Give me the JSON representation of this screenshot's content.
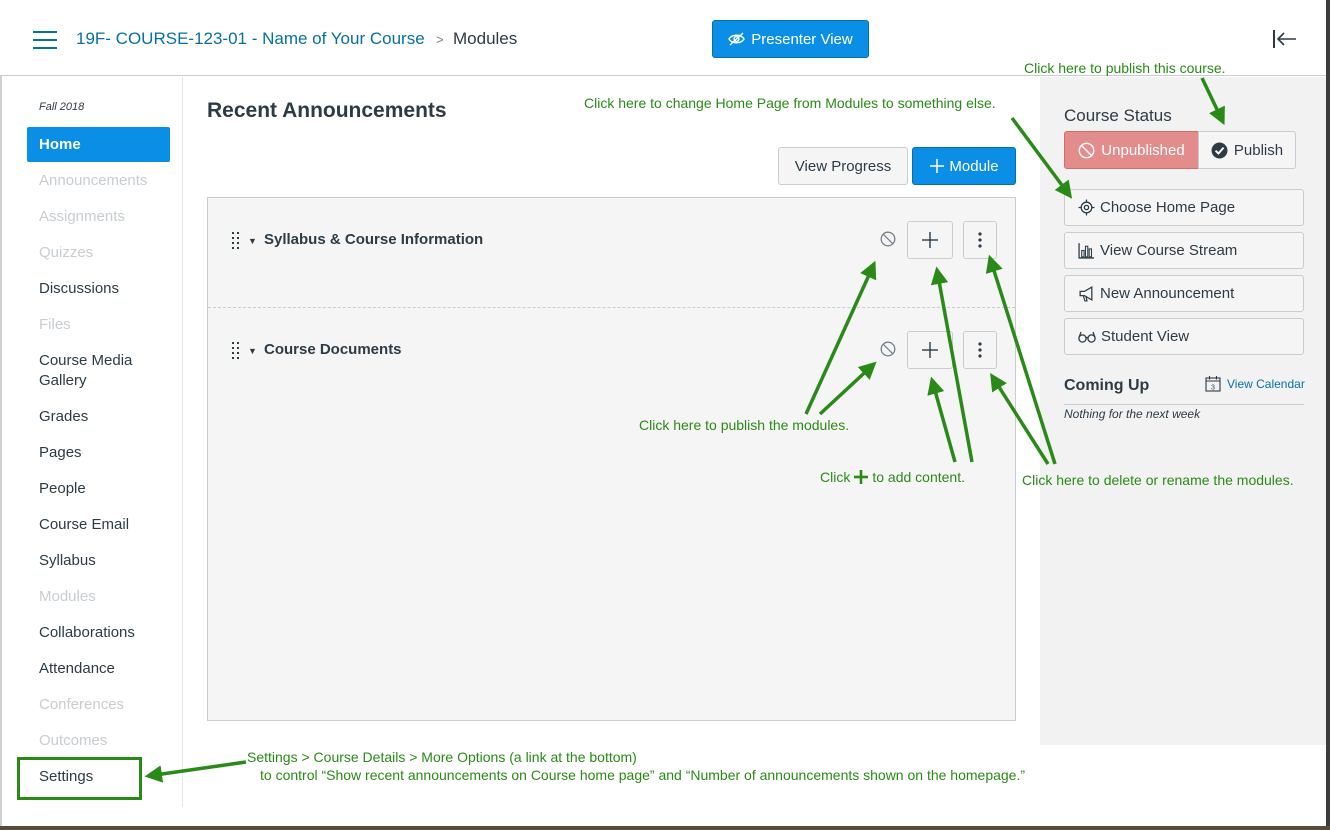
{
  "header": {
    "course_name": "19F- COURSE-123-01 - Name of Your Course",
    "separator": ">",
    "current_page": "Modules",
    "presenter_label": "Presenter View"
  },
  "sidebar": {
    "term": "Fall 2018",
    "items": [
      {
        "label": "Home",
        "state": "active"
      },
      {
        "label": "Announcements",
        "state": "hidden"
      },
      {
        "label": "Assignments",
        "state": "hidden"
      },
      {
        "label": "Quizzes",
        "state": "hidden"
      },
      {
        "label": "Discussions",
        "state": "visible"
      },
      {
        "label": "Files",
        "state": "hidden"
      },
      {
        "label": "Course Media Gallery",
        "state": "visible"
      },
      {
        "label": "Grades",
        "state": "visible"
      },
      {
        "label": "Pages",
        "state": "visible"
      },
      {
        "label": "People",
        "state": "visible"
      },
      {
        "label": "Course Email",
        "state": "visible"
      },
      {
        "label": "Syllabus",
        "state": "visible"
      },
      {
        "label": "Modules",
        "state": "hidden"
      },
      {
        "label": "Collaborations",
        "state": "visible"
      },
      {
        "label": "Attendance",
        "state": "visible"
      },
      {
        "label": "Conferences",
        "state": "hidden"
      },
      {
        "label": "Outcomes",
        "state": "hidden"
      },
      {
        "label": "Settings",
        "state": "visible"
      }
    ]
  },
  "main": {
    "recent_title": "Recent Announcements",
    "view_progress_label": "View Progress",
    "add_module_label": "Module",
    "modules": [
      {
        "title": "Syllabus & Course Information"
      },
      {
        "title": "Course Documents"
      }
    ]
  },
  "right_panel": {
    "course_status_title": "Course Status",
    "unpublished_label": "Unpublished",
    "publish_label": "Publish",
    "buttons": [
      {
        "label": "Choose Home Page",
        "icon": "target-icon"
      },
      {
        "label": "View Course Stream",
        "icon": "bar-chart-icon"
      },
      {
        "label": "New Announcement",
        "icon": "megaphone-icon"
      },
      {
        "label": "Student View",
        "icon": "glasses-icon"
      }
    ],
    "coming_up_title": "Coming Up",
    "view_calendar_label": "View Calendar",
    "calendar_day": "3",
    "nothing_text": "Nothing for the next week"
  },
  "annotations": {
    "publish_course": "Click here to publish this course.",
    "change_home": "Click here to change Home Page from Modules to something else.",
    "publish_modules": "Click here to publish the modules.",
    "add_content_prefix": "Click",
    "add_content_suffix": "to add content.",
    "delete_rename": "Click here to delete or rename the modules.",
    "settings_line1": "Settings > Course Details > More Options (a link at the bottom)",
    "settings_line2": "to control “Show recent announcements on Course home page” and “Number of announcements shown on the homepage.”"
  },
  "colors": {
    "brand_blue": "#0b8fe6",
    "link_blue": "#0770a3",
    "unpublished_red": "#e38c8c",
    "annotation_green": "#2a8a17"
  }
}
